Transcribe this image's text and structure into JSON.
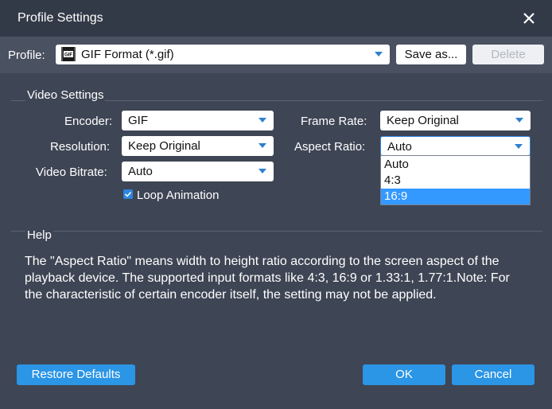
{
  "window": {
    "title": "Profile Settings"
  },
  "profile": {
    "label": "Profile:",
    "value": "GIF Format (*.gif)",
    "icon": "gif-file-icon",
    "save_as": "Save as...",
    "delete": "Delete"
  },
  "video": {
    "section_title": "Video Settings",
    "encoder_label": "Encoder:",
    "encoder_value": "GIF",
    "resolution_label": "Resolution:",
    "resolution_value": "Keep Original",
    "bitrate_label": "Video Bitrate:",
    "bitrate_value": "Auto",
    "framerate_label": "Frame Rate:",
    "framerate_value": "Keep Original",
    "aspect_label": "Aspect Ratio:",
    "aspect_value": "Auto",
    "aspect_options": [
      "Auto",
      "4:3",
      "16:9"
    ],
    "aspect_highlighted": "16:9",
    "loop_label": "Loop Animation",
    "loop_checked": true
  },
  "help": {
    "title": "Help",
    "text": "The \"Aspect Ratio\" means width to height ratio according to the screen aspect of the playback device. The supported input formats like 4:3, 16:9 or 1.33:1, 1.77:1.Note: For the characteristic of certain encoder itself, the setting may not be applied."
  },
  "footer": {
    "restore": "Restore Defaults",
    "ok": "OK",
    "cancel": "Cancel"
  },
  "colors": {
    "background": "#3e4554",
    "accent": "#2b95e6",
    "highlight": "#3399ff"
  }
}
